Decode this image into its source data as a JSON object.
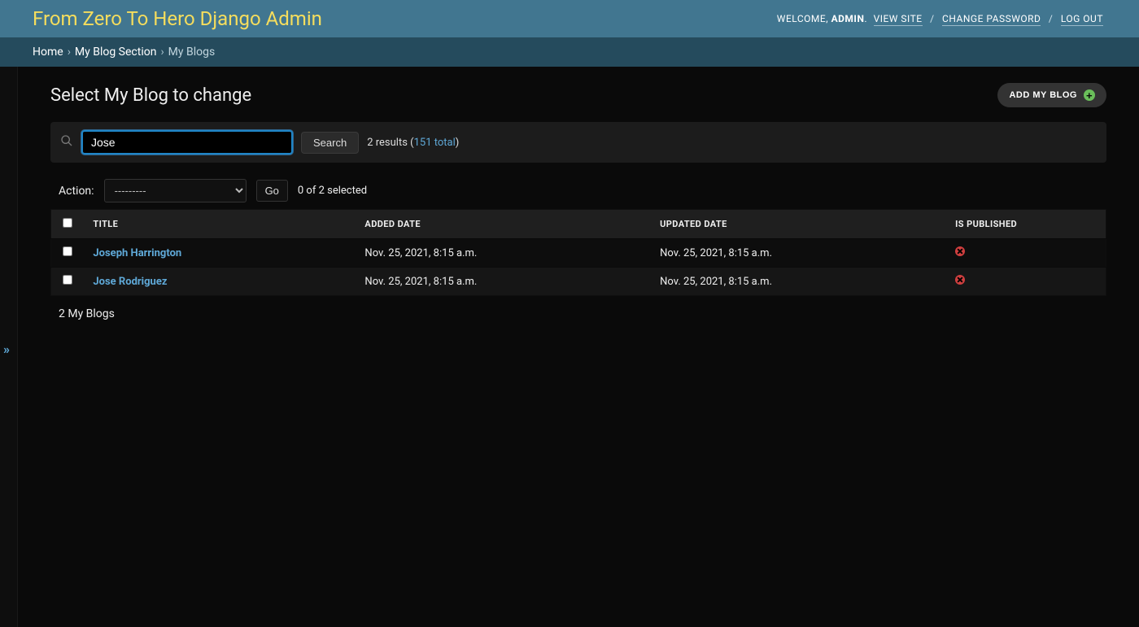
{
  "branding": {
    "title": "From Zero To Hero Django Admin"
  },
  "usertools": {
    "welcome": "WELCOME,",
    "username": "ADMIN",
    "view_site": "VIEW SITE",
    "change_password": "CHANGE PASSWORD",
    "logout": "LOG OUT"
  },
  "breadcrumbs": {
    "home": "Home",
    "section": "My Blog Section",
    "current": "My Blogs"
  },
  "sidebar": {
    "toggle_glyph": "»"
  },
  "page": {
    "title": "Select My Blog to change",
    "add_label": "ADD MY BLOG"
  },
  "search": {
    "query": "Jose",
    "button": "Search",
    "results_prefix": "2 results (",
    "total_link": "151 total",
    "results_suffix": ")"
  },
  "actionbar": {
    "label": "Action:",
    "default_option": "---------",
    "go": "Go",
    "selection": "0 of 2 selected"
  },
  "table": {
    "headers": {
      "title": "TITLE",
      "added": "ADDED DATE",
      "updated": "UPDATED DATE",
      "published": "IS PUBLISHED"
    },
    "rows": [
      {
        "title": "Joseph Harrington",
        "added": "Nov. 25, 2021, 8:15 a.m.",
        "updated": "Nov. 25, 2021, 8:15 a.m.",
        "published": false
      },
      {
        "title": "Jose Rodriguez",
        "added": "Nov. 25, 2021, 8:15 a.m.",
        "updated": "Nov. 25, 2021, 8:15 a.m.",
        "published": false
      }
    ]
  },
  "footer": {
    "count": "2 My Blogs"
  }
}
